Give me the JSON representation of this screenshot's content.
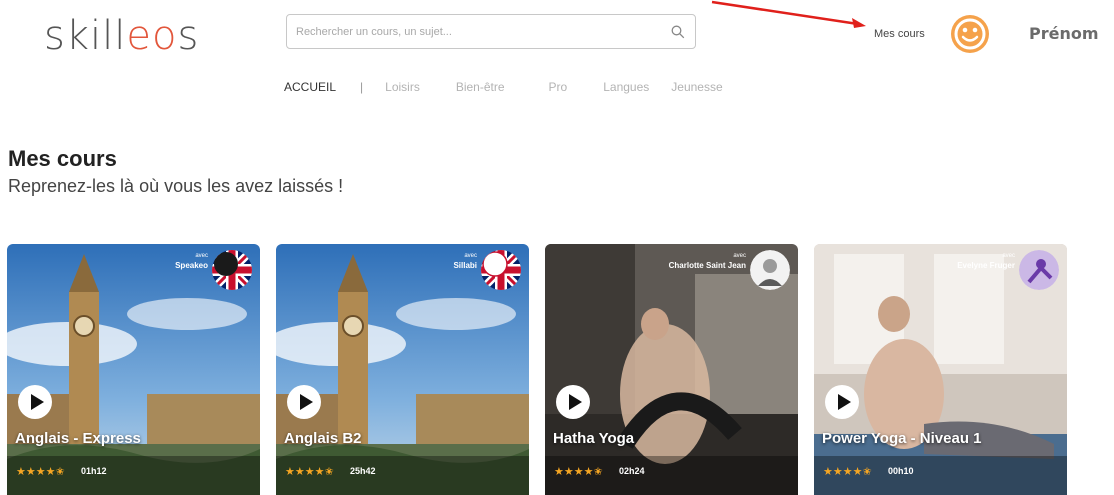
{
  "header": {
    "logo_text": "skilleos",
    "search_placeholder": "Rechercher un cours, un sujet...",
    "my_courses_link": "Mes cours",
    "user_name": "Prénom"
  },
  "nav": {
    "items": [
      {
        "label": "ACCUEIL",
        "active": true
      },
      {
        "label": "Loisirs"
      },
      {
        "label": "Bien-être"
      },
      {
        "label": "Pro"
      },
      {
        "label": "Langues"
      },
      {
        "label": "Jeunesse"
      }
    ],
    "separator": "|"
  },
  "section": {
    "title": "Mes cours",
    "subtitle": "Reprenez-les là où vous les avez laissés !"
  },
  "courses": [
    {
      "title": "Anglais - Express",
      "duration": "01h12",
      "avec": "avec",
      "instructor": "Speakeo",
      "rating": 4.5
    },
    {
      "title": "Anglais B2",
      "duration": "25h42",
      "avec": "avec",
      "instructor": "Sillabi",
      "rating": 4.5
    },
    {
      "title": "Hatha Yoga",
      "duration": "02h24",
      "avec": "avec",
      "instructor": "Charlotte Saint Jean",
      "rating": 4.5
    },
    {
      "title": "Power Yoga - Niveau 1",
      "duration": "00h10",
      "avec": "avec",
      "instructor": "Evelyne Fruger",
      "rating": 4.5
    }
  ],
  "icons": {
    "search": "search-icon",
    "avatar": "smiley-avatar-icon",
    "play": "play-icon",
    "star": "star-icon"
  },
  "colors": {
    "logo_accent": "#e2563b",
    "avatar": "#f5a24b",
    "stars": "#f5a623",
    "annotation_arrow": "#e0201b"
  }
}
